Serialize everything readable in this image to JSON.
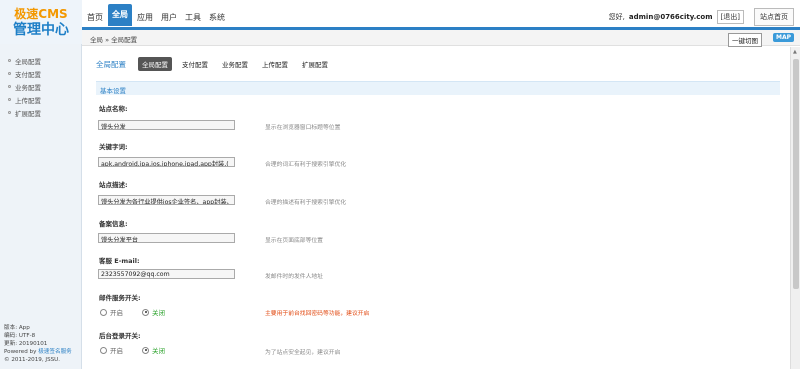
{
  "logo": {
    "line1": "极速CMS",
    "line2": "管理中心"
  },
  "nav": {
    "items": [
      {
        "label": "首页",
        "active": false
      },
      {
        "label": "全局",
        "active": true
      },
      {
        "label": "应用",
        "active": false
      },
      {
        "label": "用户",
        "active": false
      },
      {
        "label": "工具",
        "active": false
      },
      {
        "label": "系统",
        "active": false
      }
    ]
  },
  "topbar": {
    "greeting": "您好,",
    "user": "admin@0766city.com",
    "logout": "[退出]",
    "home": "站点首页"
  },
  "breadcrumb": {
    "text": "全局 » 全局配置",
    "clear_cache": "一键切图",
    "map": "MAP"
  },
  "sidebar": {
    "items": [
      "全局配置",
      "支付配置",
      "业务配置",
      "上传配置",
      "扩展配置"
    ],
    "info": {
      "version": "版本: App",
      "encoding": "编码: UTF-8",
      "updated": "更新: 20190101",
      "powered_prefix": "Powered by ",
      "powered_link": "极速签名服务",
      "copyright": "© 2011-2019, JSSU."
    }
  },
  "main": {
    "heading": "全局配置",
    "tabs": [
      "全局配置",
      "支付配置",
      "业务配置",
      "上传配置",
      "扩展配置"
    ],
    "section": "基本设置",
    "fields": {
      "site_name": {
        "label": "站点名称:",
        "value": "馒头分发",
        "hint": "显示在浏览器窗口标题等位置"
      },
      "keywords": {
        "label": "关键字词:",
        "value": "apk,android,ipa,ios,iphone,ipad,app封装,(",
        "hint": "合理的词汇有利于搜索引擎优化"
      },
      "description": {
        "label": "站点描述:",
        "value": "馒头分发为各行业提供ios企业签名、app封装、",
        "hint": "合理的描述有利于搜索引擎优化"
      },
      "icp": {
        "label": "备案信息:",
        "value": "馒头分发平台",
        "hint": "显示在页面底部等位置"
      },
      "email": {
        "label": "客服 E-mail:",
        "value": "2323557092@qq.com",
        "hint": "发邮件时的发件人地址"
      },
      "mail_switch": {
        "label": "邮件服务开关:",
        "opt_on": "开启",
        "opt_off": "关闭",
        "hint": "主要用于前台找回密码等功能，建议开启"
      },
      "admin_login": {
        "label": "后台登录开关:",
        "opt_on": "开启",
        "opt_off": "关闭",
        "hint": "为了站点安全起见，建议开启"
      }
    }
  }
}
